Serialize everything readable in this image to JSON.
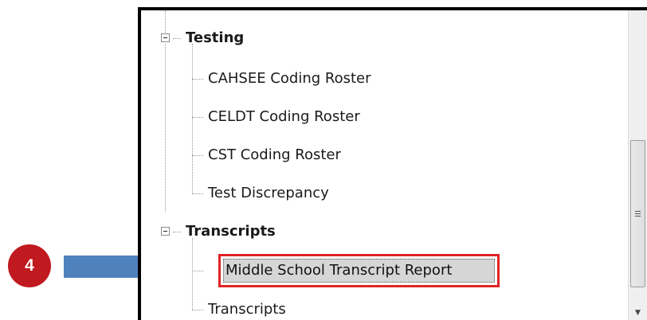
{
  "step": {
    "number": "4"
  },
  "colors": {
    "badge": "#c0191f",
    "arrow": "#4f81bd",
    "highlight": "#e02424"
  },
  "tree": {
    "categories": [
      {
        "label": "Testing",
        "expanded": true,
        "children": [
          {
            "label": "CAHSEE Coding Roster"
          },
          {
            "label": "CELDT Coding Roster"
          },
          {
            "label": "CST Coding Roster"
          },
          {
            "label": "Test Discrepancy"
          }
        ]
      },
      {
        "label": "Transcripts",
        "expanded": true,
        "children": [
          {
            "label": "Middle School Transcript Report",
            "selected": true
          },
          {
            "label": "Transcripts"
          }
        ]
      }
    ]
  },
  "scrollbar": {
    "grip_icon": "scroll-grip-icon",
    "down_icon": "scroll-down-arrow-icon"
  }
}
